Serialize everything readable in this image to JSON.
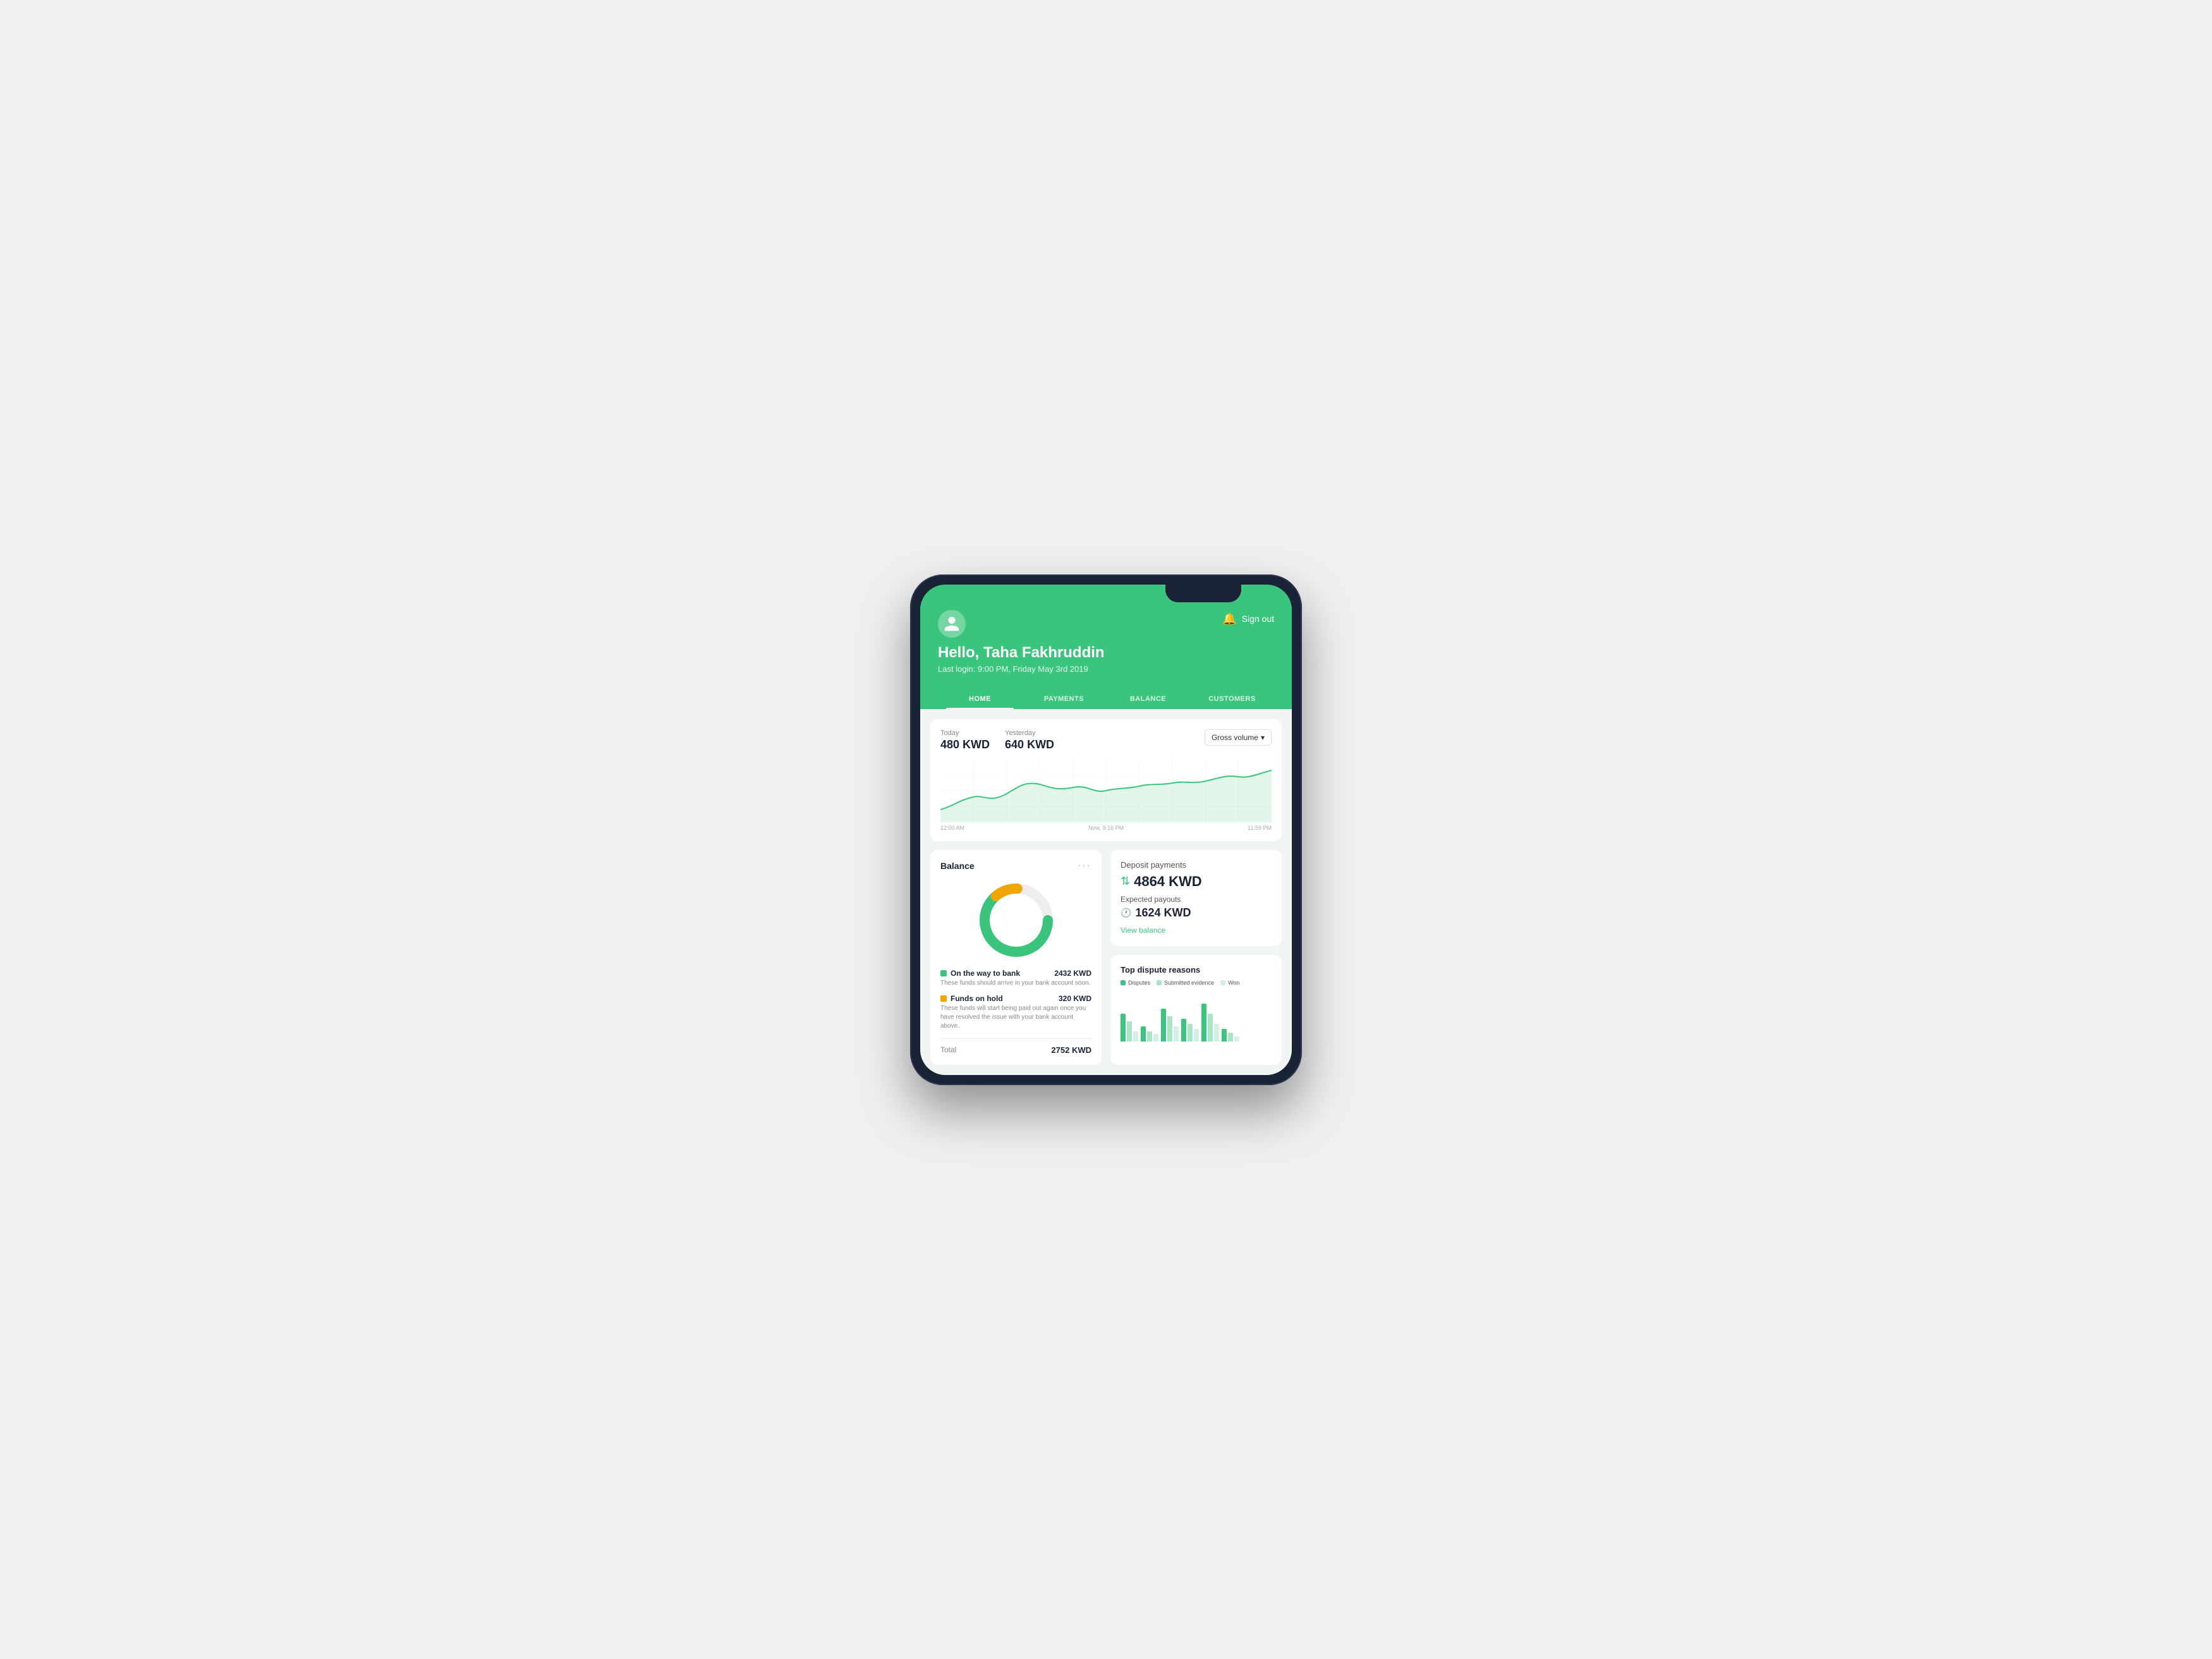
{
  "device": {
    "notch": true
  },
  "header": {
    "greeting": "Hello, Taha Fakhruddin",
    "last_login": "Last login: 9:00 PM, Friday May 3rd 2019",
    "sign_out": "Sign out"
  },
  "nav": {
    "tabs": [
      {
        "id": "home",
        "label": "HOME",
        "active": true
      },
      {
        "id": "payments",
        "label": "PAYMENTS",
        "active": false
      },
      {
        "id": "balance",
        "label": "BALANCE",
        "active": false
      },
      {
        "id": "customers",
        "label": "CUSTOMERS",
        "active": false
      }
    ]
  },
  "chart": {
    "today_label": "Today",
    "today_value": "480 KWD",
    "yesterday_label": "Yesterday",
    "yesterday_value": "640 KWD",
    "dropdown_label": "Gross volume",
    "time_start": "12:00 AM",
    "time_now": "Now, 9:16 PM",
    "time_end": "11:59 PM"
  },
  "balance_card": {
    "title": "Balance",
    "on_the_way_label": "On the way to bank",
    "on_the_way_value": "2432 KWD",
    "on_the_way_desc": "These funds should arrive in your bank account soon.",
    "funds_hold_label": "Funds on hold",
    "funds_hold_value": "320 KWD",
    "funds_hold_desc": "These funds will start being paid out again once you have resolved the issue with your bank account above.",
    "total_label": "Total",
    "total_value": "2752 KWD"
  },
  "deposit_card": {
    "deposit_label": "Deposit payments",
    "deposit_value": "4864 KWD",
    "payout_label": "Expected payouts",
    "payout_value": "1624 KWD",
    "view_balance": "View balance"
  },
  "disputes_card": {
    "title": "Top dispute reasons",
    "legend": [
      {
        "label": "Disputes",
        "color": "#3ac47d"
      },
      {
        "label": "Submitted evidence",
        "color": "#a8e6c3"
      },
      {
        "label": "Won",
        "color": "#d4f0e3"
      }
    ],
    "bars": [
      {
        "disputes": 55,
        "submitted": 40,
        "won": 20
      },
      {
        "disputes": 30,
        "submitted": 20,
        "won": 15
      },
      {
        "disputes": 65,
        "submitted": 50,
        "won": 30
      },
      {
        "disputes": 45,
        "submitted": 35,
        "won": 25
      },
      {
        "disputes": 70,
        "submitted": 55,
        "won": 35
      },
      {
        "disputes": 25,
        "submitted": 18,
        "won": 10
      }
    ]
  },
  "colors": {
    "green": "#3ac47d",
    "green_light": "#a8e6c3",
    "green_pale": "#d4f0e3",
    "navy": "#1a2235",
    "orange": "#f0a500",
    "white": "#ffffff",
    "bg": "#f0f5f3"
  }
}
